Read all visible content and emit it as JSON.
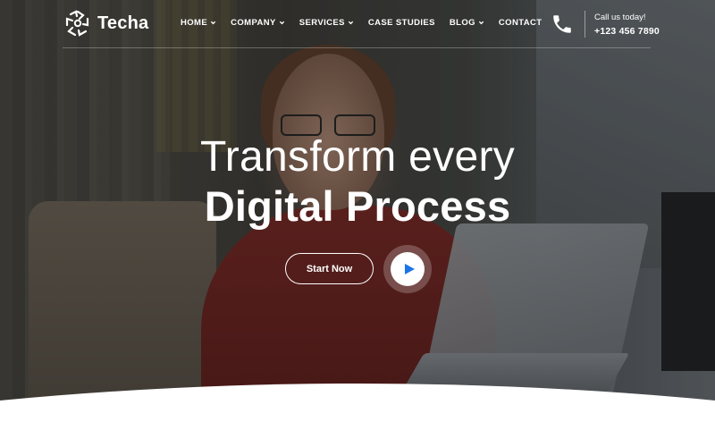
{
  "brand": {
    "name": "Techa",
    "accent": "#1b75e8"
  },
  "nav": {
    "items": [
      {
        "label": "HOME",
        "has_dropdown": true
      },
      {
        "label": "COMPANY",
        "has_dropdown": true
      },
      {
        "label": "SERVICES",
        "has_dropdown": true
      },
      {
        "label": "CASE STUDIES",
        "has_dropdown": false
      },
      {
        "label": "BLOG",
        "has_dropdown": true
      },
      {
        "label": "CONTACT",
        "has_dropdown": false
      }
    ]
  },
  "call": {
    "label": "Call us today!",
    "number": "+123 456 7890",
    "icon": "phone-icon"
  },
  "hero": {
    "headline_line1": "Transform every",
    "headline_line2": "Digital Process",
    "cta_label": "Start Now",
    "play_icon": "play-icon"
  },
  "colors": {
    "text": "#ffffff",
    "play_triangle": "#1b75e8",
    "bottom_curve": "#ffffff"
  }
}
